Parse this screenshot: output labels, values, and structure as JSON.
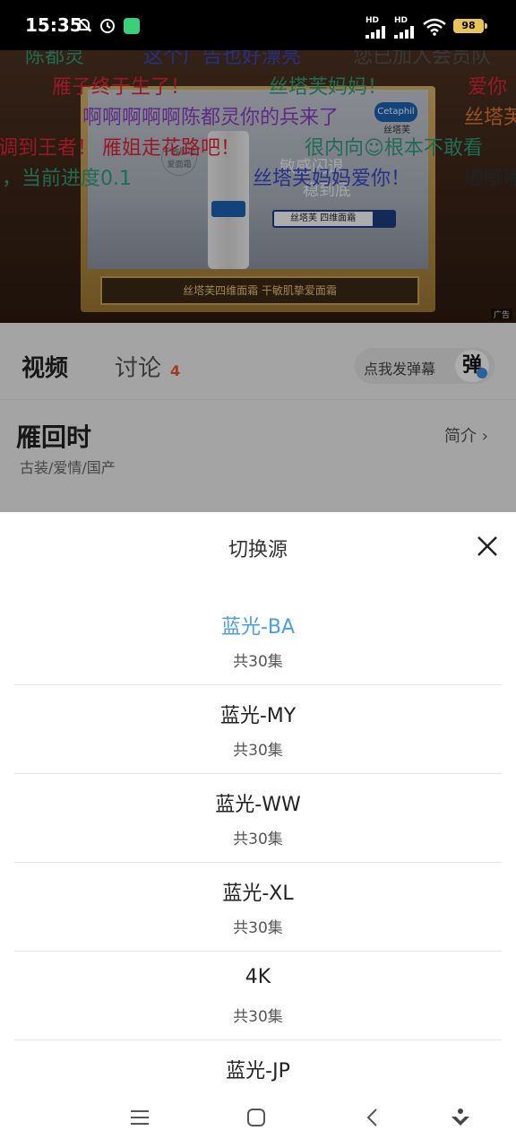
{
  "status_bar": {
    "time": "15:35",
    "hd1": "HD",
    "hd2": "HD",
    "battery": "98",
    "icons": [
      "mute-bell-icon",
      "alarm-icon",
      "app-notification-icon",
      "signal-icon",
      "signal-icon",
      "wifi-icon",
      "battery-icon"
    ]
  },
  "video": {
    "danmaku": [
      {
        "text": "陈都灵",
        "color": "#2ea07a"
      },
      {
        "text": "这个广告也好漂亮",
        "color": "#3a48c8"
      },
      {
        "text": "您已加入会员队",
        "color": "#555555"
      },
      {
        "text": "雁子终于生了！",
        "color": "#e0243a"
      },
      {
        "text": "丝塔芙妈妈！",
        "color": "#2ea07a"
      },
      {
        "text": "爱你",
        "color": "#e0243a"
      },
      {
        "text": "啊啊啊啊啊陈都灵你的兵来了",
        "color": "#8a3fc4"
      },
      {
        "text": "丝塔芙",
        "color": "#e07a2a"
      },
      {
        "text": "调到王者！",
        "color": "#e0243a"
      },
      {
        "text": "雁姐走花路吧！",
        "color": "#e0243a"
      },
      {
        "text": "很内向☺根本不敢看",
        "color": "#2ea07a"
      },
      {
        "text": "，当前进度0.1",
        "color": "#2ea07a"
      },
      {
        "text": "丝塔芙妈妈爱你！",
        "color": "#3a48c8"
      },
      {
        "text": "嘟嘟嘟",
        "color": "#333333"
      }
    ],
    "ad": {
      "logo": "Cetaphil",
      "logo_sub": "丝塔芙",
      "slogan_line1": "敏感闪退",
      "slogan_line2": "稳到底",
      "search_text": "丝塔芙 四维面霜",
      "banner": "丝塔芙四维面霜 干敏肌挚爱面霜",
      "badge": "干敏肌挚爱面霜",
      "tag": "广告"
    }
  },
  "tabs": {
    "video": "视频",
    "discuss": "讨论",
    "discuss_count": "4",
    "danmaku_prompt": "点我发弹幕",
    "danmaku_icon_text": "弹"
  },
  "info": {
    "title": "雁回时",
    "tags": "古装/爱情/国产",
    "intro": "简介 ›"
  },
  "sheet": {
    "title": "切换源",
    "sources": [
      {
        "name": "蓝光-BA",
        "count": "共30集",
        "active": true
      },
      {
        "name": "蓝光-MY",
        "count": "共30集",
        "active": false
      },
      {
        "name": "蓝光-WW",
        "count": "共30集",
        "active": false
      },
      {
        "name": "蓝光-XL",
        "count": "共30集",
        "active": false
      },
      {
        "name": "4K",
        "count": "共30集",
        "active": false
      },
      {
        "name": "蓝光-JP",
        "count": "",
        "active": false
      }
    ],
    "accent_color": "#4a9ee8"
  },
  "nav": {
    "icons": [
      "menu-icon",
      "home-icon",
      "back-icon",
      "assistant-icon"
    ]
  }
}
